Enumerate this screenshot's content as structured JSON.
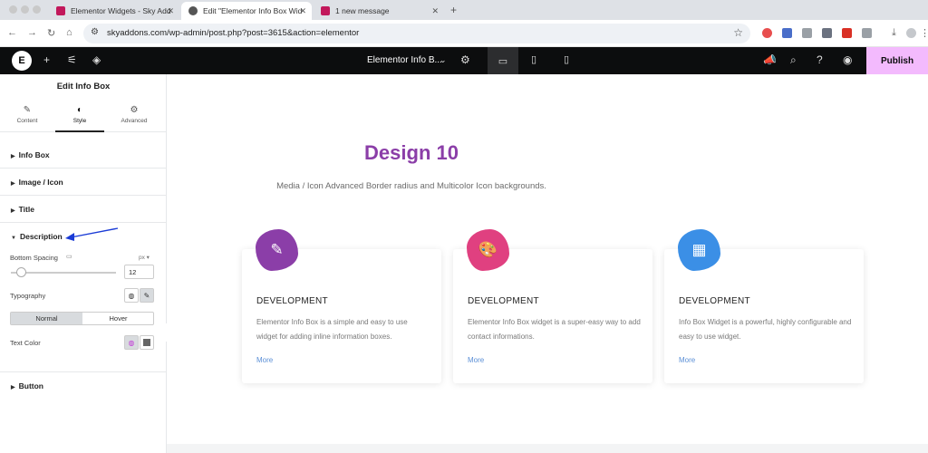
{
  "browser": {
    "tabs": [
      {
        "title": "Elementor Widgets - Sky Add",
        "active": false
      },
      {
        "title": "Edit \"Elementor Info Box Wid",
        "active": true
      },
      {
        "title": "1 new message",
        "active": false
      }
    ],
    "url": "skyaddons.com/wp-admin/post.php?post=3615&action=elementor"
  },
  "editor": {
    "document_title": "Elementor Info B...",
    "publish_label": "Publish"
  },
  "panel": {
    "title": "Edit Info Box",
    "tabs": [
      {
        "label": "Content",
        "icon": "pencil-icon"
      },
      {
        "label": "Style",
        "icon": "contrast-icon",
        "active": true
      },
      {
        "label": "Advanced",
        "icon": "gear-icon"
      }
    ],
    "sections": [
      "Info Box",
      "Image / Icon",
      "Title",
      "Description",
      "Button"
    ],
    "open_section": "Description",
    "controls": {
      "bottom_spacing_label": "Bottom Spacing",
      "bottom_spacing_unit": "px",
      "bottom_spacing_value": "12",
      "typography_label": "Typography",
      "state_normal": "Normal",
      "state_hover": "Hover",
      "text_color_label": "Text Color"
    }
  },
  "canvas": {
    "heading": "Design 10",
    "subheading": "Media / Icon Advanced Border radius and Multicolor Icon backgrounds.",
    "cards": [
      {
        "title": "DEVELOPMENT",
        "text": "Elementor Info Box is a simple and easy to use widget for adding inline information boxes.",
        "link": "More",
        "icon": "brush-icon",
        "color": "#8b3ea8"
      },
      {
        "title": "DEVELOPMENT",
        "text": "Elementor Info Box widget is a super-easy way to add contact informations.",
        "link": "More",
        "icon": "palette-icon",
        "color": "#e04080"
      },
      {
        "title": "DEVELOPMENT",
        "text": "Info Box Widget is a powerful, highly configurable and easy to use widget.",
        "link": "More",
        "icon": "image-icon",
        "color": "#3b8fe6"
      }
    ]
  },
  "colors": {
    "accent_purple": "#8b3ea8",
    "publish_bg": "#f3bafd",
    "arrow_blue": "#1a3bd6"
  }
}
